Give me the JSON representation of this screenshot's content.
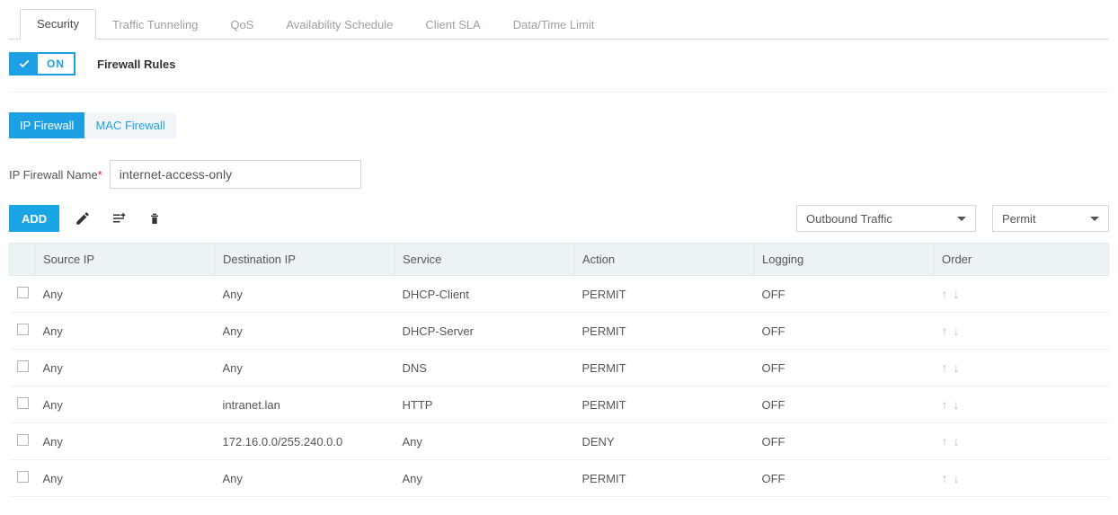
{
  "tabs": {
    "items": [
      {
        "label": "Security",
        "active": true
      },
      {
        "label": "Traffic Tunneling",
        "active": false
      },
      {
        "label": "QoS",
        "active": false
      },
      {
        "label": "Availability Schedule",
        "active": false
      },
      {
        "label": "Client SLA",
        "active": false
      },
      {
        "label": "Data/Time Limit",
        "active": false
      }
    ]
  },
  "toggle": {
    "state": "ON"
  },
  "section_title": "Firewall Rules",
  "subtabs": {
    "items": [
      {
        "label": "IP Firewall",
        "active": true
      },
      {
        "label": "MAC Firewall",
        "active": false
      }
    ]
  },
  "name_field": {
    "label": "IP Firewall Name",
    "value": "internet-access-only"
  },
  "toolbar": {
    "add_label": "ADD",
    "traffic_select": "Outbound Traffic",
    "action_select": "Permit"
  },
  "table": {
    "headers": {
      "source": "Source IP",
      "dest": "Destination IP",
      "service": "Service",
      "action": "Action",
      "logging": "Logging",
      "order": "Order"
    },
    "rows": [
      {
        "source": "Any",
        "dest": "Any",
        "service": "DHCP-Client",
        "action": "PERMIT",
        "logging": "OFF"
      },
      {
        "source": "Any",
        "dest": "Any",
        "service": "DHCP-Server",
        "action": "PERMIT",
        "logging": "OFF"
      },
      {
        "source": "Any",
        "dest": "Any",
        "service": "DNS",
        "action": "PERMIT",
        "logging": "OFF"
      },
      {
        "source": "Any",
        "dest": "intranet.lan",
        "service": "HTTP",
        "action": "PERMIT",
        "logging": "OFF"
      },
      {
        "source": "Any",
        "dest": "172.16.0.0/255.240.0.0",
        "service": "Any",
        "action": "DENY",
        "logging": "OFF"
      },
      {
        "source": "Any",
        "dest": "Any",
        "service": "Any",
        "action": "PERMIT",
        "logging": "OFF"
      }
    ]
  }
}
